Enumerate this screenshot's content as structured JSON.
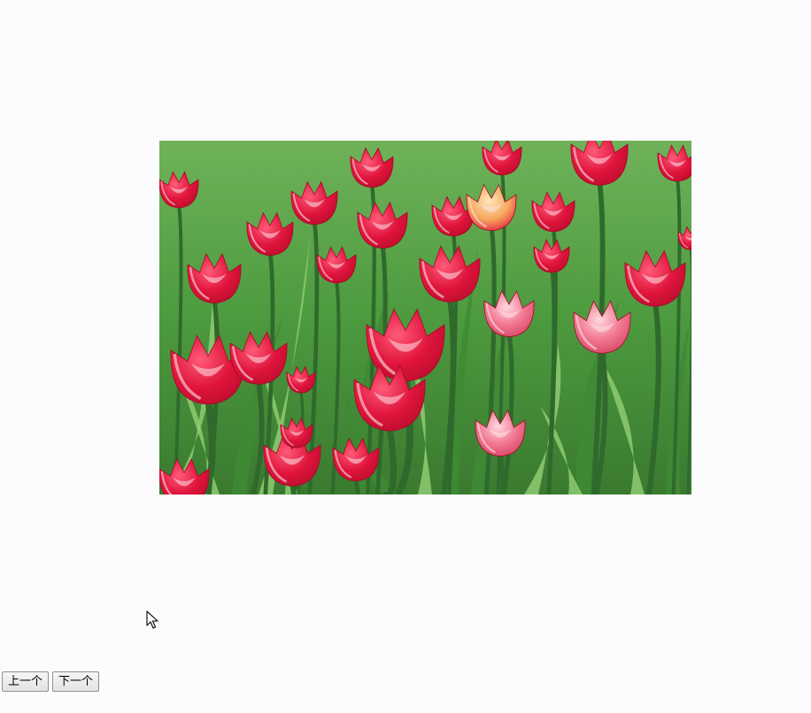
{
  "carousel": {
    "image": {
      "subject": "tulip-field",
      "colors": {
        "petal": "#e0143c",
        "petal_light": "#f27a93",
        "petal_highlight": "#ffe2e8",
        "leaf": "#3f8a35",
        "leaf_light": "#8fcb72",
        "stem": "#2f6a2c"
      }
    },
    "controls": {
      "prev_label": "上一个",
      "next_label": "下一个"
    }
  },
  "cursor": {
    "icon": "arrow-cursor-icon"
  }
}
